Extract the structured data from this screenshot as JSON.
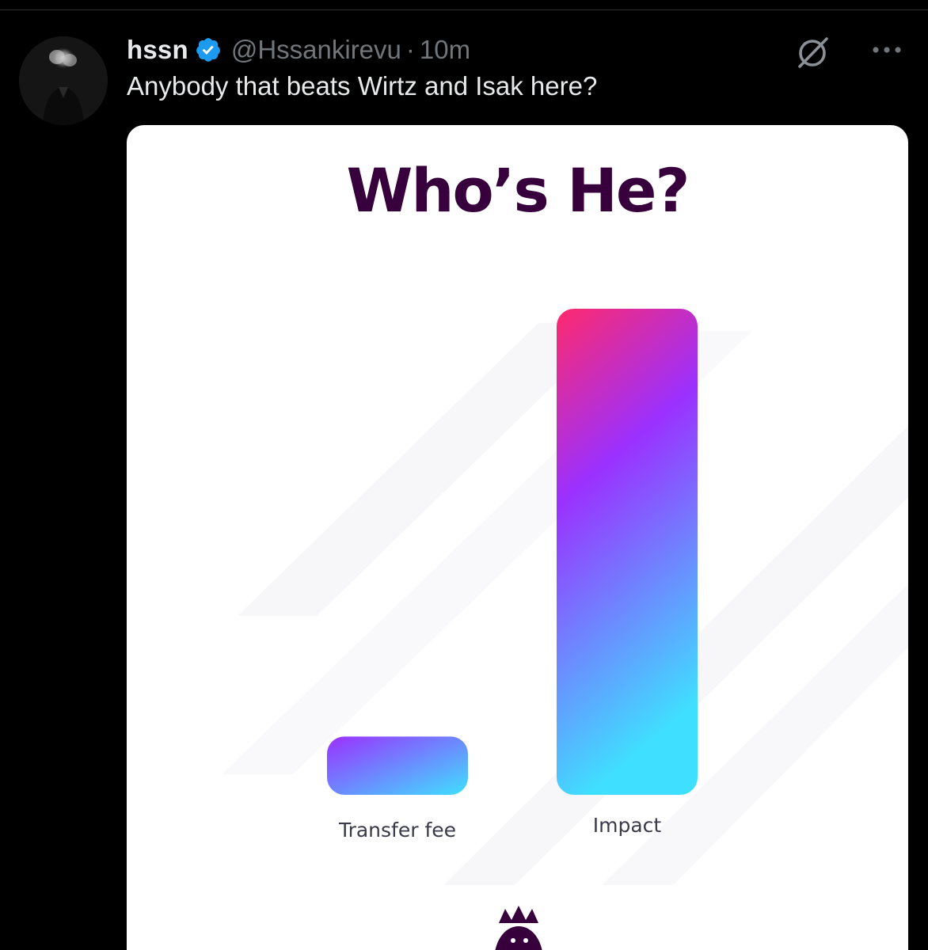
{
  "tweet": {
    "display_name": "hssn",
    "handle": "@Hssankirevu",
    "separator": "·",
    "time": "10m",
    "text": "Anybody that beats Wirtz and Isak here?",
    "verified": true,
    "icons": {
      "verified": "verified-badge-icon",
      "grok": "grok-icon",
      "more": "more-options-icon"
    },
    "colors": {
      "background": "#000000",
      "text_primary": "#e7e9ea",
      "text_secondary": "#71767b",
      "verified_blue": "#1d9bf0"
    }
  },
  "media": {
    "title": "Who’s He?",
    "logo": "premier-league-lion-logo",
    "chart_data": {
      "type": "bar",
      "title": "Who’s He?",
      "categories": [
        "Transfer fee",
        "Impact"
      ],
      "values": [
        0.12,
        1.0
      ],
      "grid": false,
      "value_labels_shown": false,
      "colors": {
        "title": "#37003c",
        "gradient_top": "#ff2a6d",
        "gradient_mid": "#9b30ff",
        "gradient_bottom": "#3fe0ff"
      }
    }
  }
}
